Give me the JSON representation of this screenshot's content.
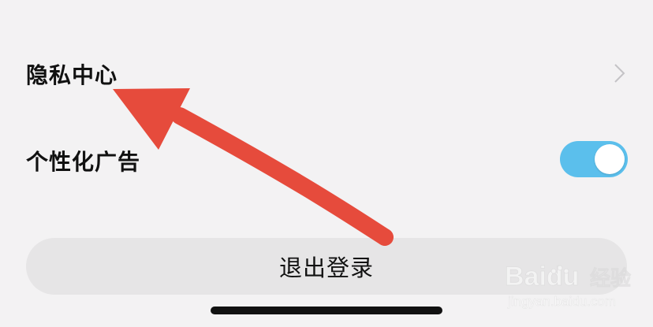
{
  "settings": {
    "privacy_center": {
      "label": "隐私中心"
    },
    "personalized_ads": {
      "label": "个性化广告",
      "enabled": true
    }
  },
  "logout": {
    "label": "退出登录"
  },
  "colors": {
    "background": "#f3f2f3",
    "toggle_on": "#5bbfec",
    "annotation_arrow": "#e64b3c",
    "button_background": "#e6e5e6"
  },
  "watermark": {
    "brand": "Baidu",
    "product": "经验",
    "url": "jingyan.baidu.com"
  }
}
